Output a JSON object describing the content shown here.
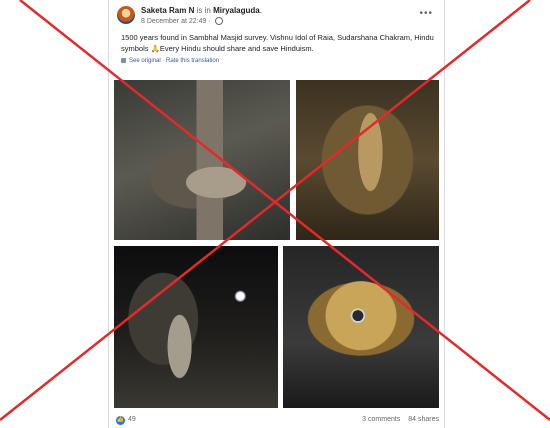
{
  "post": {
    "author": "Saketa Ram N",
    "is_in": "is in",
    "location": "Miryalaguda",
    "location_suffix": ".",
    "timestamp": "8 December at 22:49 ·",
    "text": "1500 years found in Sambhal Masjid survey. Vishnu Idol of Raia, Sudarshana Chakram, Hindu symbols 🙏Every Hindu should share and save Hinduism.",
    "see_original": "See original · Rate this translation",
    "more_icon": "•••"
  },
  "footer": {
    "like_count": "49",
    "comments": "3 comments",
    "shares": "84 shares"
  },
  "icons": {
    "like": "like-icon",
    "globe": "globe-icon",
    "cross": "red-x-overlay"
  },
  "colors": {
    "cross": "#e32a2a",
    "like": "#1877f2",
    "link": "#385898"
  }
}
